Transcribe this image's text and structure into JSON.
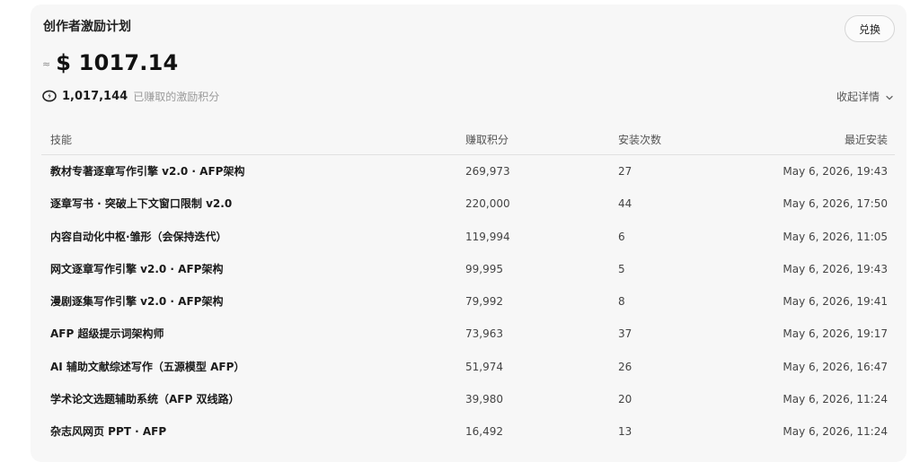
{
  "card": {
    "title": "创作者激励计划",
    "redeem_label": "兑换",
    "approx_symbol": "≈",
    "amount": "$ 1017.14",
    "points_value": "1,017,144",
    "points_label": "已赚取的激励积分",
    "collapse_label": "收起详情"
  },
  "table": {
    "headers": {
      "skill": "技能",
      "points": "赚取积分",
      "installs": "安装次数",
      "last_install": "最近安装"
    },
    "rows": [
      {
        "skill": "教材专著逐章写作引擎 v2.0 · AFP架构",
        "points": "269,973",
        "installs": "27",
        "last_install": "May 6, 2026, 19:43"
      },
      {
        "skill": "逐章写书 · 突破上下文窗口限制 v2.0",
        "points": "220,000",
        "installs": "44",
        "last_install": "May 6, 2026, 17:50"
      },
      {
        "skill": "内容自动化中枢·雏形（会保持迭代）",
        "points": "119,994",
        "installs": "6",
        "last_install": "May 6, 2026, 11:05"
      },
      {
        "skill": "网文逐章写作引擎 v2.0 · AFP架构",
        "points": "99,995",
        "installs": "5",
        "last_install": "May 6, 2026, 19:43"
      },
      {
        "skill": "漫剧逐集写作引擎 v2.0 · AFP架构",
        "points": "79,992",
        "installs": "8",
        "last_install": "May 6, 2026, 19:41"
      },
      {
        "skill": "AFP 超级提示词架构师",
        "points": "73,963",
        "installs": "37",
        "last_install": "May 6, 2026, 19:17"
      },
      {
        "skill": "AI 辅助文献综述写作（五源模型 AFP）",
        "points": "51,974",
        "installs": "26",
        "last_install": "May 6, 2026, 16:47"
      },
      {
        "skill": "学术论文选题辅助系统（AFP 双线路）",
        "points": "39,980",
        "installs": "20",
        "last_install": "May 6, 2026, 11:24"
      },
      {
        "skill": "杂志风网页 PPT · AFP",
        "points": "16,492",
        "installs": "13",
        "last_install": "May 6, 2026, 11:24"
      }
    ]
  },
  "icons": {
    "coin": "coin-icon",
    "chevron": "chevron-down-icon"
  }
}
